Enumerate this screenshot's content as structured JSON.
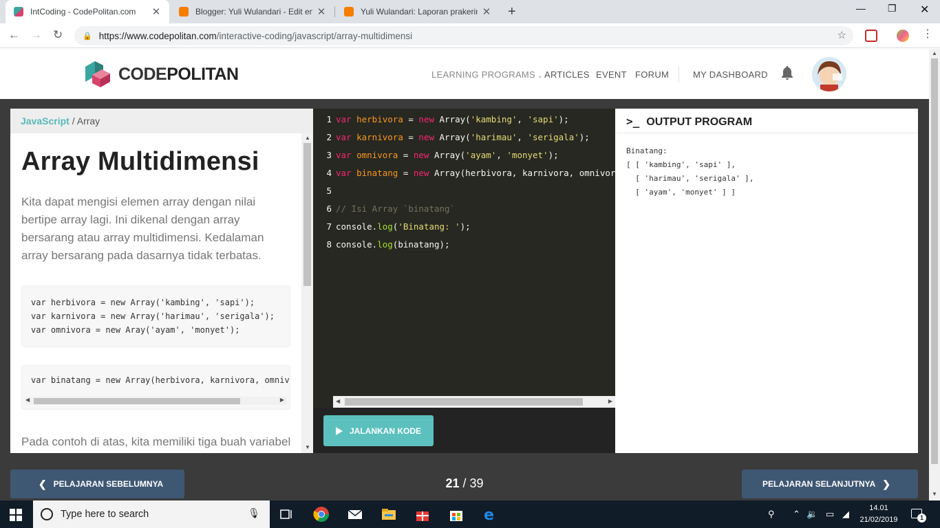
{
  "browser": {
    "tabs": [
      {
        "title": "IntCoding - CodePolitan.com",
        "active": true
      },
      {
        "title": "Blogger: Yuli Wulandari - Edit ent",
        "active": false
      },
      {
        "title": "Yuli Wulandari: Laporan prakerin",
        "active": false
      }
    ],
    "url_host": "https://www.codepolitan.com",
    "url_path": "/interactive-coding/javascript/array-multidimensi"
  },
  "site": {
    "logo_part1": "CODE",
    "logo_part2": "POLITAN",
    "nav": [
      "LEARNING PROGRAMS",
      "ARTICLES",
      "EVENT",
      "FORUM",
      "MY DASHBOARD"
    ]
  },
  "lesson": {
    "breadcrumb_lang": "JavaScript",
    "breadcrumb_topic": " / Array",
    "title": "Array Multidimensi",
    "intro": "Kita dapat mengisi elemen array dengan nilai bertipe array lagi. Ini dikenal dengan array bersarang atau array multidimensi. Kedalaman array bersarang pada dasarnya tidak terbatas.",
    "snippet1": "var herbivora = new Array('kambing', 'sapi');\nvar karnivora = new Array('harimau', 'serigala');\nvar omnivora = new Aray('ayam', 'monyet');",
    "snippet2": "var binatang = new Array(herbivora, karnivora, omnivora);",
    "para2": "Pada contoh di atas, kita memiliki tiga buah variabel"
  },
  "editor": {
    "lines": [
      "1",
      "2",
      "3",
      "4",
      "5",
      "6",
      "7",
      "8"
    ],
    "run_label": "JALANKAN KODE"
  },
  "output": {
    "heading": "OUTPUT PROGRAM",
    "prompt_glyph": ">_",
    "text": "Binatang:\n[ [ 'kambing', 'sapi' ],\n  [ 'harimau', 'serigala' ],\n  [ 'ayam', 'monyet' ] ]"
  },
  "pager": {
    "prev_label": "PELAJARAN SEBELUMNYA",
    "next_label": "PELAJARAN SELANJUTNYA",
    "current": "21",
    "total": "39"
  },
  "taskbar": {
    "search_placeholder": "Type here to search",
    "time": "14.01",
    "date": "21/02/2019",
    "notifications": "1"
  },
  "colors": {
    "accent": "#5bc0be",
    "pager_button": "#3e5773",
    "editor_bg": "#272822",
    "page_bg": "#3b3b3b"
  },
  "icons": [
    "chrome-favicon",
    "blogger-favicon",
    "back-icon",
    "forward-icon",
    "reload-icon",
    "lock-icon",
    "star-icon",
    "bell-icon",
    "play-icon",
    "chevron-left-icon",
    "chevron-right-icon",
    "windows-start-icon",
    "search-icon",
    "mic-icon"
  ]
}
